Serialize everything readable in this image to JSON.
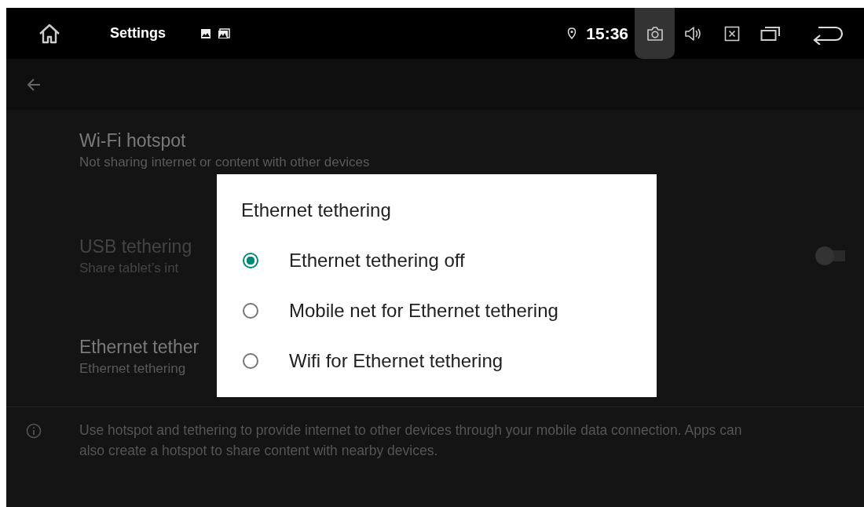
{
  "status_bar": {
    "app_title": "Settings",
    "time": "15:36"
  },
  "settings_items": [
    {
      "title": "Wi-Fi hotspot",
      "subtitle": "Not sharing internet or content with other devices",
      "disabled": false
    },
    {
      "title": "USB tethering",
      "subtitle": "Share tablet’s int",
      "disabled": true,
      "toggle": {
        "on": false
      }
    },
    {
      "title": "Ethernet tether",
      "subtitle": "Ethernet tethering",
      "disabled": false
    }
  ],
  "footer_note": "Use hotspot and tethering to provide internet to other devices through your mobile data connection. Apps can also create a hotspot to share content with nearby devices.",
  "dialog": {
    "title": "Ethernet tethering",
    "options": [
      {
        "label": "Ethernet tethering off",
        "selected": true
      },
      {
        "label": "Mobile net for Ethernet tethering",
        "selected": false
      },
      {
        "label": "Wifi for Ethernet tethering",
        "selected": false
      }
    ]
  }
}
